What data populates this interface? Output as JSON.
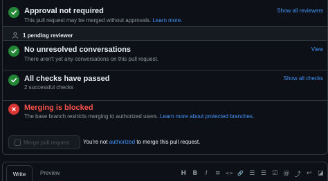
{
  "checks": {
    "approval": {
      "title": "Approval not required",
      "description": "This pull request may be merged without approvals.",
      "link": "Learn more.",
      "action": "Show all reviewers",
      "icon": "check-circle-icon",
      "color": "#238636"
    },
    "pending_reviewers": {
      "label": "1 pending reviewer",
      "icon": "person-icon"
    },
    "conversations": {
      "title": "No unresolved conversations",
      "description": "There aren't yet any conversations on this pull request.",
      "action": "View",
      "icon": "check-circle-icon",
      "color": "#238636"
    },
    "checks_passed": {
      "title": "All checks have passed",
      "description": "2 successful checks",
      "action": "Show all checks",
      "icon": "check-circle-icon",
      "color": "#238636"
    },
    "blocked": {
      "title": "Merging is blocked",
      "description": "The base branch restricts merging to authorized users.",
      "link": "Learn more about protected branches.",
      "icon": "x-circle-icon",
      "color": "#da3633"
    }
  },
  "merge": {
    "button_label": "Merge pull request",
    "note_prefix": "You're not",
    "note_link": "authorized",
    "note_suffix": "to merge this pull request."
  },
  "editor": {
    "tabs": [
      "Write",
      "Preview"
    ],
    "toolbar": [
      {
        "name": "heading-icon",
        "glyph": "H"
      },
      {
        "name": "bold-icon",
        "glyph": "B"
      },
      {
        "name": "italic-icon",
        "glyph": "I"
      },
      {
        "name": "quote-icon",
        "glyph": "≡"
      },
      {
        "name": "code-icon",
        "glyph": "<>"
      },
      {
        "name": "link-icon",
        "glyph": "🔗"
      },
      {
        "name": "numbered-list-icon",
        "glyph": "☰"
      },
      {
        "name": "unordered-list-icon",
        "glyph": "☰"
      },
      {
        "name": "task-list-icon",
        "glyph": "☑"
      },
      {
        "name": "mention-icon",
        "glyph": "@"
      },
      {
        "name": "cross-reference-icon",
        "glyph": "⤴"
      },
      {
        "name": "reply-icon",
        "glyph": "↩"
      },
      {
        "name": "slash-commands-icon",
        "glyph": "◪"
      }
    ]
  }
}
